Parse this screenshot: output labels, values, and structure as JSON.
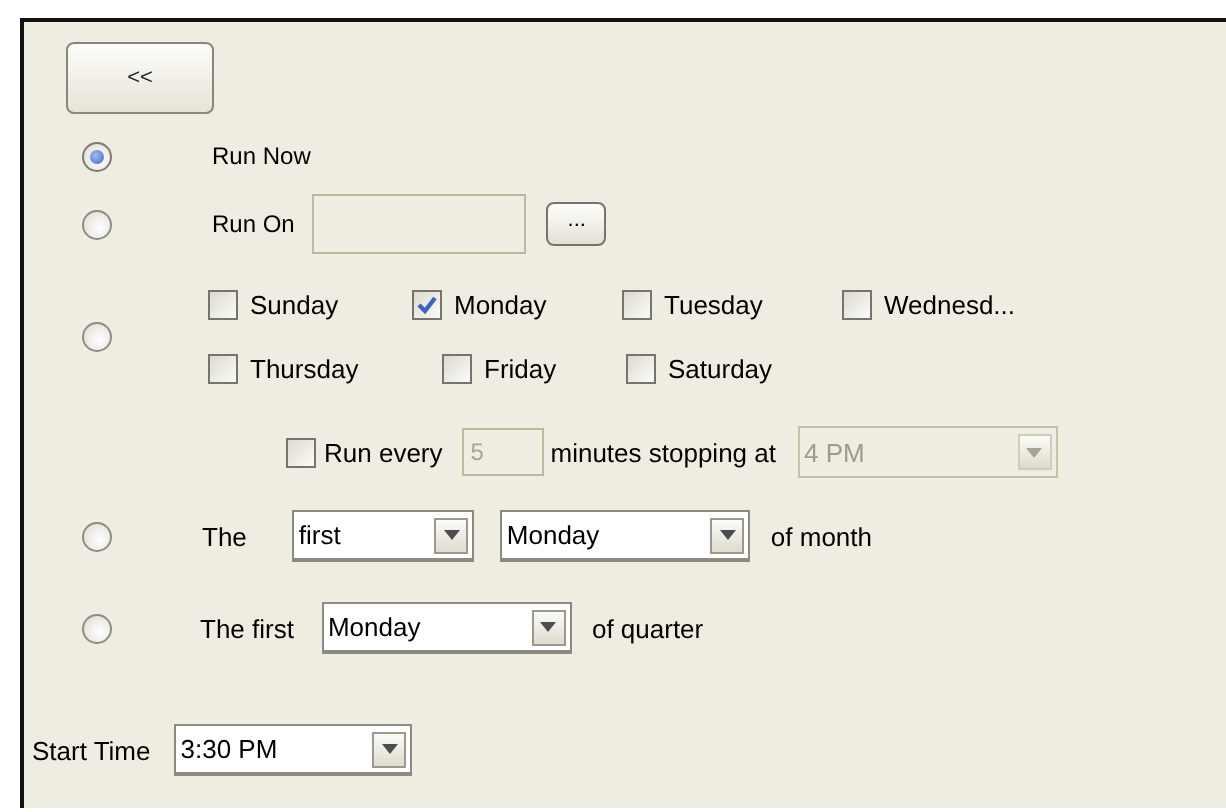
{
  "back_button": {
    "label": "<<"
  },
  "options": [
    {
      "kind": "now",
      "selected": true,
      "label": "Run Now"
    },
    {
      "kind": "date",
      "selected": false,
      "label": "Run On",
      "browse_button": "..."
    },
    {
      "kind": "weekly",
      "selected": false,
      "days": [
        {
          "label": "Sunday",
          "checked": false
        },
        {
          "label": "Monday",
          "checked": true
        },
        {
          "label": "Tuesday",
          "checked": false
        },
        {
          "label": "Wednesd...",
          "checked": false
        },
        {
          "label": "Thursday",
          "checked": false
        },
        {
          "label": "Friday",
          "checked": false
        },
        {
          "label": "Saturday",
          "checked": false
        }
      ],
      "repeat": {
        "checked": false,
        "label": "Run every",
        "interval": "5",
        "interval_disabled": true,
        "middle_label": "minutes stopping at",
        "stop_time": "4 PM",
        "stop_time_disabled": true
      }
    },
    {
      "kind": "monthly",
      "selected": false,
      "label": "The",
      "ordinal": "first",
      "weekday": "Monday",
      "suffix": "of month"
    },
    {
      "kind": "quarterly",
      "selected": false,
      "label": "The first",
      "weekday": "Monday",
      "suffix": "of quarter"
    }
  ],
  "start_time": {
    "label": "Start Time",
    "value": "3:30 PM"
  }
}
